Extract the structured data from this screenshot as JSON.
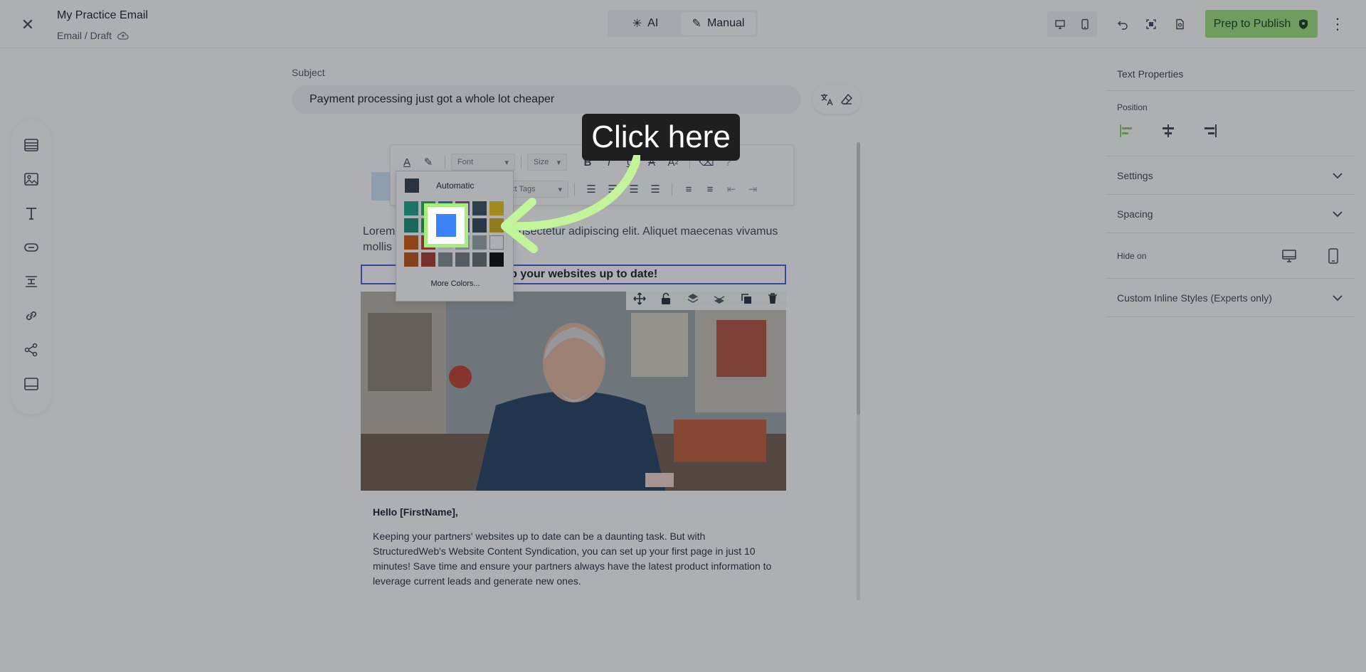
{
  "topbar": {
    "close_icon": "close-icon",
    "title": "My Practice Email",
    "path": "Email / Draft",
    "modes": {
      "ai_label": "AI",
      "manual_label": "Manual"
    },
    "publish_label": "Prep to Publish"
  },
  "subject": {
    "label": "Subject",
    "value": "Payment processing just got a whole lot cheaper"
  },
  "format_toolbar": {
    "font_label": "Font",
    "size_label": "Size",
    "tags_label": "ct Tags"
  },
  "color_picker": {
    "automatic_label": "Automatic",
    "automatic_color": "#2d3748",
    "swatches": [
      "#16a085",
      "#27ae60",
      "#2980b9",
      "#8e44ad",
      "#34495e",
      "#f1c40f",
      "#138d75",
      "#229954",
      "#1f6fb2",
      "#7d3c98",
      "#2c3e50",
      "#d4ac0d",
      "#d35400",
      "#c0392b",
      "#ecf0f1",
      "#bdc3c7",
      "#95a5a6",
      "#ffffff",
      "#b9500a",
      "#a93226",
      "#7f8c8d",
      "#707b7c",
      "#616a6b",
      "#000000"
    ],
    "more_label": "More Colors..."
  },
  "canvas": {
    "lorem": "Lorem ipsum dolor sit amet, consectetur adipiscing elit. Aliquet maecenas vivamus mollis a",
    "heading": "Keep your websites up to date!",
    "greeting": "Hello [FirstName],",
    "body": "Keeping your partners' websites up to date can be a daunting task. But with StructuredWeb's Website Content Syndication, you can set up your first page in just 10 minutes! Save time and ensure your partners always have the latest product information to leverage current leads and generate new ones."
  },
  "right_panel": {
    "header": "Text Properties",
    "position_label": "Position",
    "settings_label": "Settings",
    "spacing_label": "Spacing",
    "hide_on_label": "Hide on",
    "custom_styles_label": "Custom Inline Styles (Experts only)"
  },
  "overlay": {
    "callout": "Click here",
    "highlight_color": "#a4f07a"
  }
}
